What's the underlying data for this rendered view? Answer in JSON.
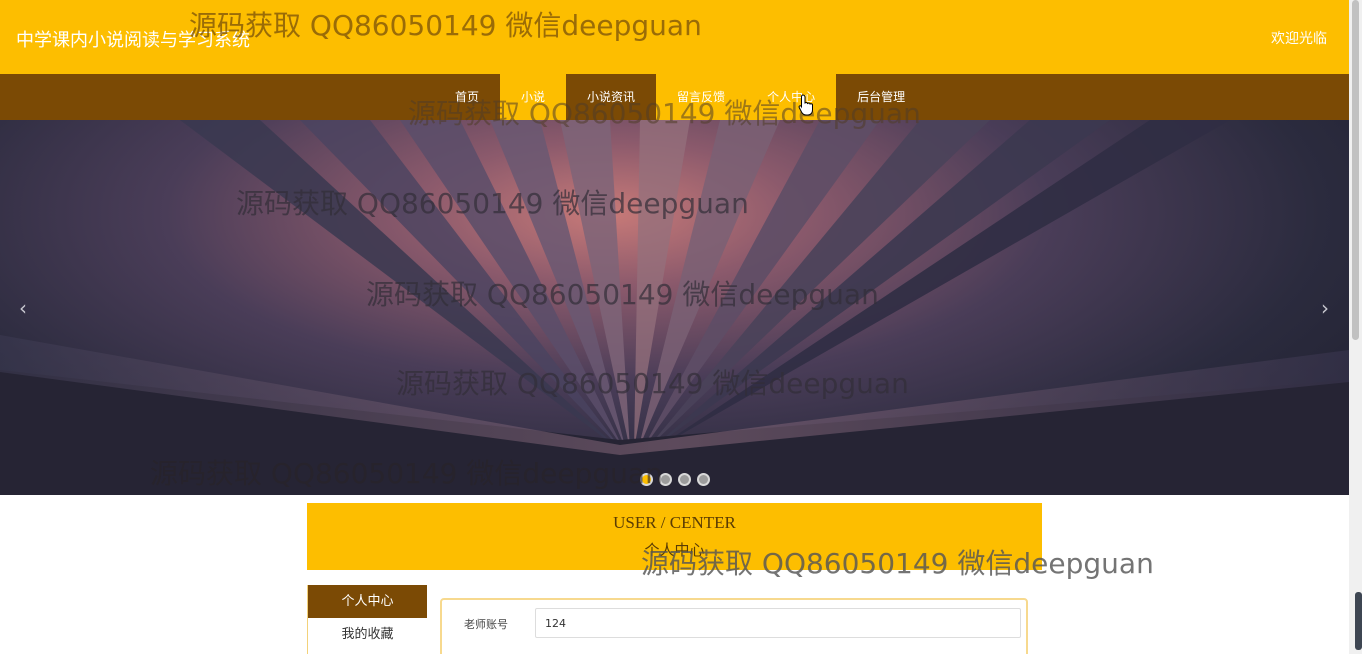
{
  "header": {
    "site_title": "中学课内小说阅读与学习系统",
    "welcome": "欢迎光临"
  },
  "nav": {
    "items": [
      {
        "label": "首页"
      },
      {
        "label": "小说"
      },
      {
        "label": "小说资讯"
      },
      {
        "label": "留言反馈"
      },
      {
        "label": "个人中心"
      },
      {
        "label": "后台管理"
      }
    ],
    "active_index": 4
  },
  "banner": {
    "prev_arrow": "‹",
    "next_arrow": "›",
    "slide_count": 4,
    "active_slide": 0
  },
  "user_center": {
    "title_en": "USER / CENTER",
    "title_cn": "个人中心",
    "menu": [
      {
        "label": "个人中心"
      },
      {
        "label": "我的收藏"
      }
    ],
    "form": {
      "account_label": "老师账号",
      "account_value": "124"
    }
  },
  "watermark": "源码获取 QQ86050149 微信deepguan",
  "colors": {
    "accent": "#fdbe00",
    "nav_brown": "#7b4a05"
  }
}
